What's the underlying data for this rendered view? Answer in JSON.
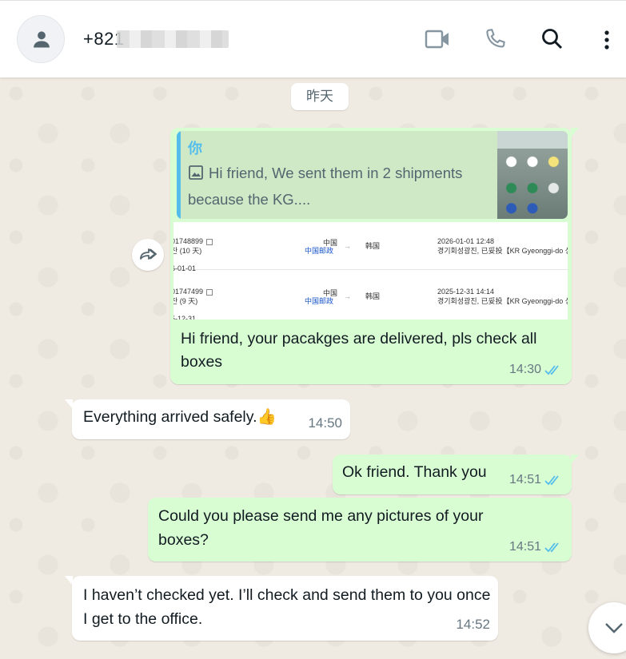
{
  "header": {
    "contact_name": "+821",
    "icons": [
      "person-icon",
      "video-call-icon",
      "voice-call-icon",
      "search-icon",
      "menu-icon"
    ]
  },
  "date_divider": "昨天",
  "messages": [
    {
      "direction": "out",
      "quote": {
        "author": "你",
        "text": "Hi friend,  We sent them in 2 shipments because the KG....",
        "icon": "image-icon"
      },
      "tracking": [
        {
          "id": "01748899",
          "days": "잔 (10 天)",
          "date0": "6-01-01",
          "from": "中国",
          "from_en": "中国邮政",
          "arrow": "→",
          "to": "韩国",
          "datetime": "2026-01-01 12:48",
          "location": "경기회성광진, 已妥投【KR Gyeonggi-do 성"
        },
        {
          "id": "01747499",
          "days": "잔 (9 天)",
          "date0": "5-12-31",
          "from": "中国",
          "from_en": "中国邮政",
          "arrow": "→",
          "to": "韩国",
          "datetime": "2025-12-31 14:14",
          "location": "경기회성광진, 已妥投【KR Gyeonggi-do 성"
        }
      ],
      "text": "Hi friend, your pacakges are delivered, pls check all boxes",
      "time": "14:30",
      "status": "read"
    },
    {
      "direction": "in",
      "text": "Everything arrived safely.👍",
      "time": "14:50"
    },
    {
      "direction": "out",
      "text": "Ok friend. Thank you",
      "time": "14:51",
      "status": "read"
    },
    {
      "direction": "out",
      "text": "Could you please send me any pictures of your boxes?",
      "time": "14:51",
      "status": "read"
    },
    {
      "direction": "in",
      "text": "I haven’t checked yet. I’ll check and send them to you once I get to the office.",
      "time": "14:52"
    }
  ],
  "colors": {
    "outgoing_bubble": "#d9fdd3",
    "incoming_bubble": "#ffffff",
    "read_ticks": "#53bdeb",
    "chat_background": "#efeae2"
  }
}
